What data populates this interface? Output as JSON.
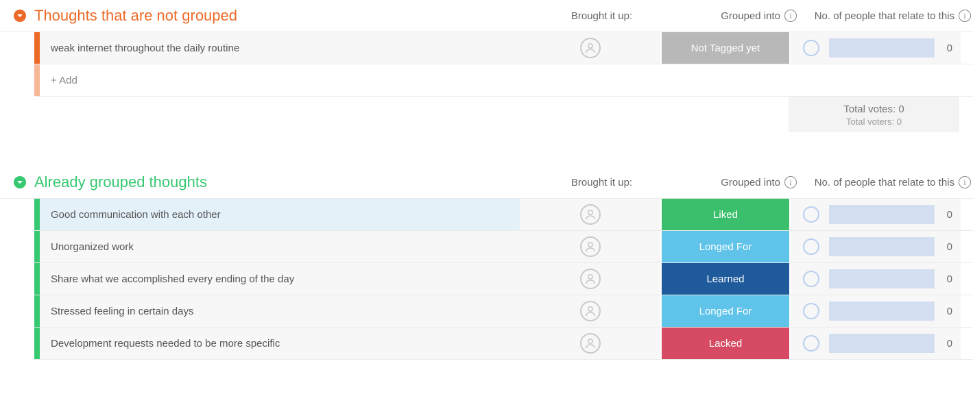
{
  "columns": {
    "brought": "Brought it up:",
    "grouped": "Grouped into",
    "relate": "No. of people that relate to this"
  },
  "totals": {
    "votes_label": "Total votes:",
    "votes_value": "0",
    "voters_label": "Total voters:",
    "voters_value": "0"
  },
  "tags": {
    "not_tagged": "Not Tagged yet",
    "liked": "Liked",
    "longed": "Longed For",
    "learned": "Learned",
    "lacked": "Lacked"
  },
  "add_label": "+ Add",
  "sections": [
    {
      "id": "ungrouped",
      "title": "Thoughts that are not grouped",
      "color": "orange",
      "rows": [
        {
          "text": "weak internet throughout the daily routine",
          "tag": "not_tagged",
          "count": "0",
          "highlight": false
        }
      ],
      "show_add": true,
      "show_totals": true
    },
    {
      "id": "grouped",
      "title": "Already grouped thoughts",
      "color": "green",
      "rows": [
        {
          "text": "Good communication with each other",
          "tag": "liked",
          "count": "0",
          "highlight": true
        },
        {
          "text": "Unorganized work",
          "tag": "longed",
          "count": "0",
          "highlight": false
        },
        {
          "text": "Share what we accomplished every ending of the day",
          "tag": "learned",
          "count": "0",
          "highlight": false
        },
        {
          "text": "Stressed feeling in certain days",
          "tag": "longed",
          "count": "0",
          "highlight": false
        },
        {
          "text": "Development requests needed to be more specific",
          "tag": "lacked",
          "count": "0",
          "highlight": false
        }
      ],
      "show_add": false,
      "show_totals": false
    }
  ]
}
